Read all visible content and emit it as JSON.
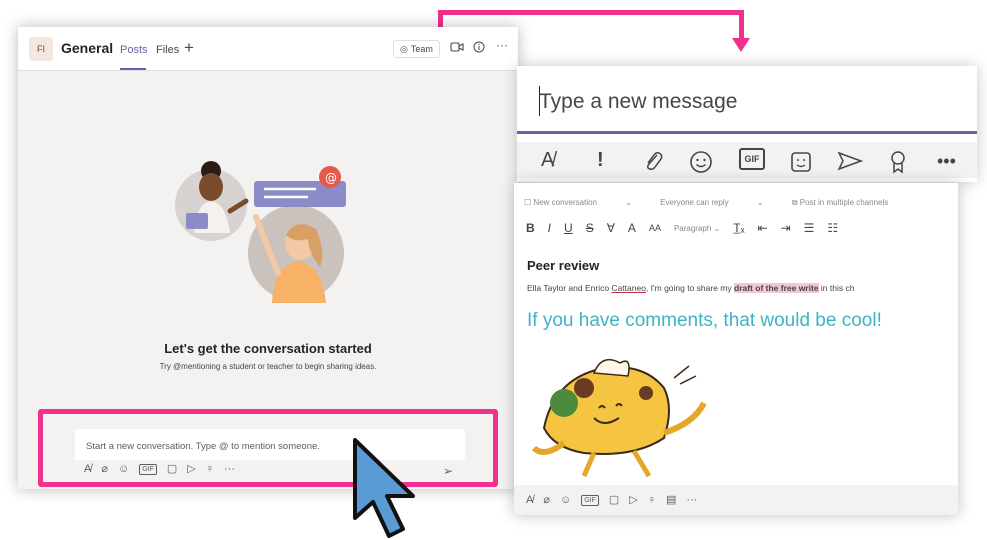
{
  "left_window": {
    "avatar": "FI",
    "channel": "General",
    "tabs": [
      "Posts",
      "Files"
    ],
    "add_tab": "+",
    "team_button": "Team",
    "empty_title": "Let's get the conversation started",
    "empty_subtitle": "Try @mentioning a student or teacher to begin sharing ideas.",
    "compose_placeholder": "Start a new conversation. Type @ to mention someone."
  },
  "message_panel": {
    "placeholder": "Type a new message",
    "gif_label": "GIF"
  },
  "editor_panel": {
    "top_bar": [
      "New conversation",
      "Everyone can reply",
      "Post in multiple channels"
    ],
    "paragraph_label": "Paragraph",
    "title": "Peer review",
    "body_prefix": "Ella Taylor and Enrico ",
    "body_underlined": "Cattaneo",
    "body_mid": ", I'm going to share my ",
    "body_highlight": "draft of the free write",
    "body_suffix": " in this ch",
    "large_text": "If you have comments, that would be cool!"
  },
  "colors": {
    "highlight": "#f0308c",
    "teams_purple": "#6264a7",
    "teal_text": "#3cb4c4",
    "cursor_fill": "#5b9bd5"
  },
  "icons": [
    "format-icon",
    "priority-icon",
    "attach-icon",
    "emoji-icon",
    "gif-icon",
    "sticker-icon",
    "meet-icon",
    "praise-icon",
    "more-icon",
    "send-icon",
    "video-icon",
    "info-icon"
  ]
}
